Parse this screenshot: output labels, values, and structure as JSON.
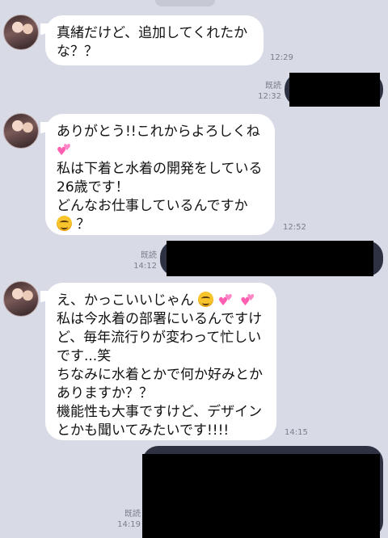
{
  "messages": [
    {
      "lines": [
        "真緒だけど、追加してくれたか",
        "な？？"
      ],
      "time": "12:29"
    },
    {
      "read": "既読",
      "time": "12:32"
    },
    {
      "lines": [
        "ありがとう!!これからよろしくね",
        "私は下着と水着の開発をしている",
        "26歳です！",
        "どんなお仕事しているんですか",
        "？"
      ],
      "time": "12:52"
    },
    {
      "read": "既読",
      "time": "14:12"
    },
    {
      "lines": [
        "え、かっこいいじゃん",
        "私は今水着の部署にいるんですけ",
        "ど、毎年流行りが変わって忙しい",
        "です...笑",
        "ちなみに水着とかで何か好みとか",
        "ありますか？？",
        "機能性も大事ですけど、デザイン",
        "とかも聞いてみたいです!!!!"
      ],
      "time": "14:15"
    },
    {
      "read": "既読",
      "time": "14:19"
    }
  ],
  "emoji": {
    "smile": "smile-emoji",
    "hearts": "two-hearts-emoji"
  }
}
